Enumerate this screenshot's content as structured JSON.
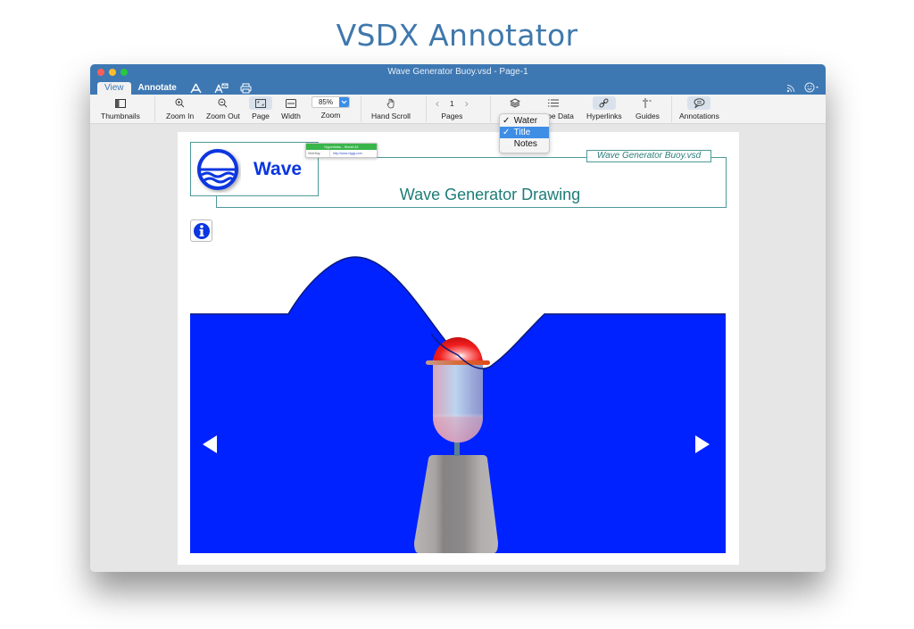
{
  "hero": {
    "title": "VSDX Annotator"
  },
  "window": {
    "title": "Wave Generator Buoy.vsd - Page-1",
    "tabs": [
      {
        "label": "View",
        "active": true
      },
      {
        "label": "Annotate",
        "active": false
      }
    ],
    "tab_icons": [
      "acrobat-icon",
      "acrobat-mail-icon",
      "print-icon"
    ],
    "right_icons": [
      "rss-icon",
      "smiley-menu-icon"
    ]
  },
  "toolbar": {
    "thumbnails": "Thumbnails",
    "zoom_in": "Zoom In",
    "zoom_out": "Zoom Out",
    "page": "Page",
    "width": "Width",
    "zoom": "Zoom",
    "zoom_value": "85%",
    "hand_scroll": "Hand Scroll",
    "pages": "Pages",
    "page_number": "1",
    "shape_data": "Shape Data",
    "hyperlinks": "Hyperlinks",
    "guides": "Guides",
    "annotations": "Annotations"
  },
  "layers_menu": {
    "items": [
      {
        "label": "Water",
        "checked": true,
        "highlighted": false
      },
      {
        "label": "Title",
        "checked": true,
        "highlighted": true
      },
      {
        "label": "Notes",
        "checked": false,
        "highlighted": false
      }
    ],
    "check_glyph": "✓"
  },
  "drawing": {
    "logo_text": "Wave",
    "filename_tag": "Wave Generator Buoy.vsd",
    "title": "Wave Generator Drawing",
    "hyperlink_tooltip": {
      "header": "Hyperlinks - Sheet.32",
      "name": "Visit Buy",
      "url": "http://www.viggy.com"
    },
    "colors": {
      "water": "#0022ff",
      "frame": "#4e9a99",
      "title": "#1d7d77",
      "buoy_cap": "#e81818",
      "base": "#a8a4a4"
    }
  }
}
